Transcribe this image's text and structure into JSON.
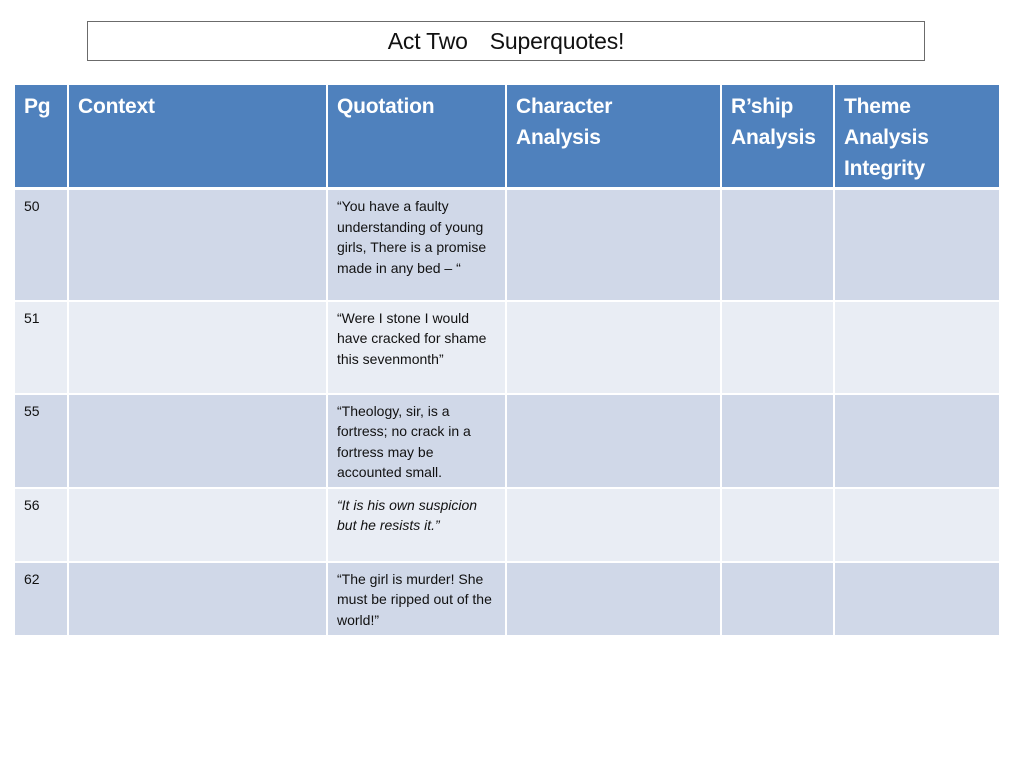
{
  "title": {
    "part1": "Act Two",
    "part2": "Superquotes!"
  },
  "colors": {
    "header_bg": "#4f81bd",
    "row_dark": "#d0d8e8",
    "row_light": "#e9edf4"
  },
  "table": {
    "headers": {
      "pg": "Pg",
      "context": "Context",
      "quotation": "Quotation",
      "character_line1": "Character",
      "character_line2": "Analysis",
      "rship_line1": "R’ship",
      "rship_line2": "Analysis",
      "theme_line1": "Theme",
      "theme_line2": "Analysis",
      "theme_line3": "Integrity"
    },
    "rows": [
      {
        "pg": "50",
        "context": "",
        "quotation": "“You have a faulty understanding of young girls, There is a promise made in any bed – “",
        "italic": false,
        "character": "",
        "rship": "",
        "theme": ""
      },
      {
        "pg": "51",
        "context": "",
        "quotation": "“Were I stone I would have cracked for shame this sevenmonth”",
        "italic": false,
        "character": "",
        "rship": "",
        "theme": ""
      },
      {
        "pg": "55",
        "context": "",
        "quotation": "“Theology, sir, is a fortress; no crack in a fortress may be accounted small.",
        "italic": false,
        "character": "",
        "rship": "",
        "theme": ""
      },
      {
        "pg": "56",
        "context": "",
        "quotation": "“It is his own suspicion but he resists it.”",
        "italic": true,
        "character": "",
        "rship": "",
        "theme": ""
      },
      {
        "pg": "62",
        "context": "",
        "quotation": "“The girl is murder! She must be ripped out of the world!”",
        "italic": false,
        "character": "",
        "rship": "",
        "theme": ""
      }
    ]
  }
}
